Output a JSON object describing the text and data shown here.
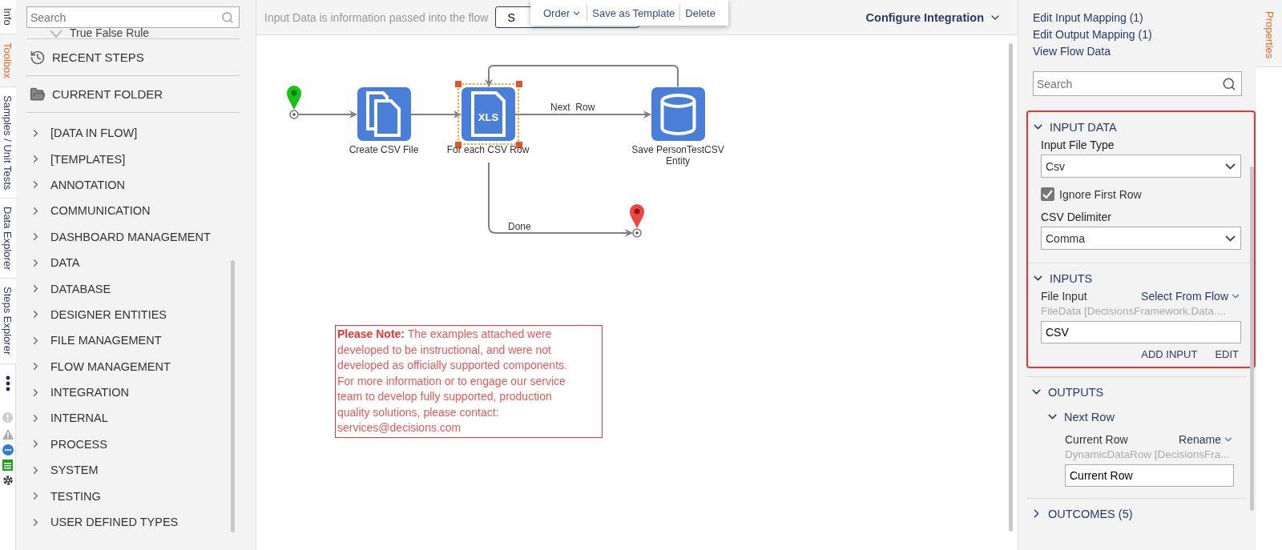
{
  "left_tabs": [
    {
      "label": "Info",
      "selected": false
    },
    {
      "label": "Toolbox",
      "selected": true
    },
    {
      "label": "Samples / Unit Tests",
      "selected": false
    },
    {
      "label": "Data Explorer",
      "selected": false
    },
    {
      "label": "Steps Explorer",
      "selected": false
    }
  ],
  "toolbox": {
    "search": {
      "placeholder": "Search"
    },
    "partial_item": "True False Rule",
    "sections": [
      {
        "label": "RECENT STEPS",
        "kind": "recent"
      },
      {
        "label": "CURRENT FOLDER",
        "kind": "folder"
      }
    ],
    "tree": [
      {
        "label": "[DATA IN FLOW]",
        "expanded": false
      },
      {
        "label": "[TEMPLATES]",
        "expanded": false
      },
      {
        "label": "ANNOTATION",
        "expanded": false
      },
      {
        "label": "COMMUNICATION",
        "expanded": false
      },
      {
        "label": "DASHBOARD MANAGEMENT",
        "expanded": false
      },
      {
        "label": "DATA",
        "expanded": false
      },
      {
        "label": "DATABASE",
        "expanded": false
      },
      {
        "label": "DESIGNER ENTITIES",
        "expanded": false
      },
      {
        "label": "FILE MANAGEMENT",
        "expanded": false
      },
      {
        "label": "FLOW MANAGEMENT",
        "expanded": false
      },
      {
        "label": "INTEGRATION",
        "expanded": false
      },
      {
        "label": "INTERNAL",
        "expanded": false
      },
      {
        "label": "PROCESS",
        "expanded": false
      },
      {
        "label": "SYSTEM",
        "expanded": false
      },
      {
        "label": "TESTING",
        "expanded": false
      },
      {
        "label": "USER DEFINED TYPES",
        "expanded": false
      }
    ]
  },
  "canvas": {
    "hint": "Input Data is information passed into the flow",
    "hidden_button": "S",
    "menu": [
      {
        "label": "Order",
        "kind": "dropdown"
      },
      {
        "label": "Save as Template",
        "kind": "action"
      },
      {
        "label": "Delete",
        "kind": "action"
      }
    ],
    "configure": "Configure Integration",
    "nodes": [
      {
        "label": "Create CSV File",
        "kind": "files",
        "selected": false
      },
      {
        "label": "For each CSV Row",
        "kind": "xls",
        "icon_text": "XLS",
        "selected": true
      },
      {
        "label": "Save PersonTestCSV Entity",
        "kind": "database",
        "selected": false
      }
    ],
    "edge_labels": [
      "Next  Row",
      "Done"
    ],
    "note": "**Please Note:** The examples attached were developed to be instructional, and were not developed as officially supported components. For more information or to engage our service team to develop fully supported, production quality solutions, please contact: services@decisions.com"
  },
  "properties": {
    "links": [
      "Edit Input Mapping (1)",
      "Edit Output Mapping (1)",
      "View Flow Data"
    ],
    "search": {
      "placeholder": "Search"
    },
    "input_data": {
      "title": "INPUT DATA",
      "expanded": true,
      "file_type_label": "Input File Type",
      "file_type": "Csv",
      "ignore_first_row": {
        "label": "Ignore First Row",
        "checked": true
      },
      "delimiter_label": "CSV Delimiter",
      "delimiter": "Comma"
    },
    "inputs": {
      "title": "INPUTS",
      "expanded": true,
      "name": "File Input",
      "action": "Select From Flow",
      "type": "FileData [DecisionsFramework.Data....",
      "value": "CSV",
      "buttons": [
        "ADD INPUT",
        "EDIT"
      ]
    },
    "outputs": {
      "title": "OUTPUTS",
      "expanded": true,
      "group": "Next Row",
      "group_expanded": true,
      "name": "Current Row",
      "action": "Rename",
      "type": "DynamicDataRow [DecisionsFra...",
      "value": "Current Row"
    },
    "outcomes": {
      "title": "OUTCOMES (5)",
      "expanded": false
    }
  },
  "right_tab": {
    "label": "Properties",
    "selected": true
  }
}
